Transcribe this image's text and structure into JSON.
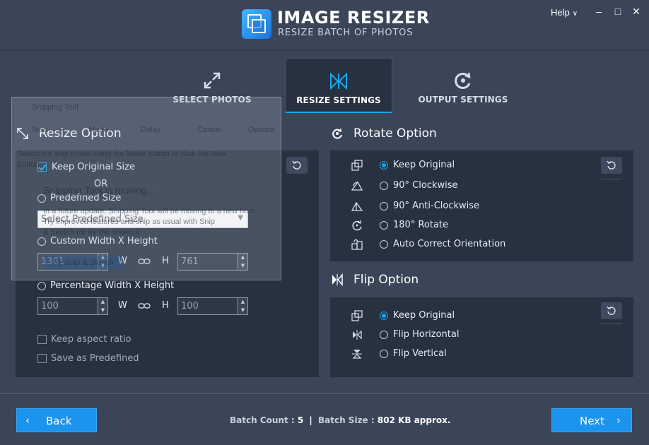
{
  "app": {
    "title": "IMAGE RESIZER",
    "subtitle": "RESIZE BATCH OF PHOTOS",
    "help_label": "Help"
  },
  "tabs": [
    {
      "label": "SELECT PHOTOS",
      "icon": "expand-arrows-icon",
      "active": false
    },
    {
      "label": "RESIZE SETTINGS",
      "icon": "resize-bowtie-icon",
      "active": true
    },
    {
      "label": "OUTPUT SETTINGS",
      "icon": "output-refresh-icon",
      "active": false
    }
  ],
  "resize": {
    "title": "Resize Option",
    "keep_original_label": "Keep Original Size",
    "or_label": "OR",
    "predefined_label": "Predefined Size",
    "predefined_value": "Select Predefined Size",
    "custom_label": "Custom Width X Height",
    "custom_width": "1361",
    "custom_height": "761",
    "percentage_label": "Percentage Width X Height",
    "percent_width": "100",
    "percent_height": "100",
    "w_label": "W",
    "h_label": "H",
    "keep_aspect_label": "Keep aspect ratio",
    "save_predefined_label": "Save as Predefined"
  },
  "rotate": {
    "title": "Rotate Option",
    "options": [
      {
        "label": "Keep Original",
        "icon": "keep-original-icon",
        "selected": true
      },
      {
        "label": "90° Clockwise",
        "icon": "rotate-clockwise-icon",
        "selected": false
      },
      {
        "label": "90° Anti-Clockwise",
        "icon": "rotate-anticlockwise-icon",
        "selected": false
      },
      {
        "label": "180° Rotate",
        "icon": "rotate-180-icon",
        "selected": false
      },
      {
        "label": "Auto Correct Orientation",
        "icon": "auto-orientation-icon",
        "selected": false
      }
    ]
  },
  "flip": {
    "title": "Flip Option",
    "options": [
      {
        "label": "Keep Original",
        "icon": "keep-original-icon",
        "selected": true
      },
      {
        "label": "Flip Horizontal",
        "icon": "flip-horizontal-icon",
        "selected": false
      },
      {
        "label": "Flip Vertical",
        "icon": "flip-vertical-icon",
        "selected": false
      }
    ]
  },
  "snipping_overlay": {
    "title": "Snipping Tool",
    "new_label": "New",
    "mode_label": "Mode",
    "delay_label": "Delay",
    "cancel_label": "Cancel",
    "options_label": "Options",
    "hint_line1": "Select the snip mode using the Mode button or click the New",
    "hint_line2": "button.",
    "moving_title": "Snipping Tool is moving...",
    "moving_line1": "In a future update, Snipping Tool will be moving to a new home.",
    "moving_line2": "Try improved features and snip as usual with Snip",
    "moving_line3": "& Sketch (or try the shortcut",
    "snip_button": "Try Snip & Sketch"
  },
  "footer": {
    "back_label": "Back",
    "next_label": "Next",
    "batch_count_label": "Batch Count :",
    "batch_count_value": "5",
    "separator": "|",
    "batch_size_label": "Batch Size :",
    "batch_size_value": "802 KB approx."
  },
  "colors": {
    "background": "#3a4558",
    "panel": "#27313f",
    "accent": "#19a7f0",
    "button": "#1c93ec"
  }
}
